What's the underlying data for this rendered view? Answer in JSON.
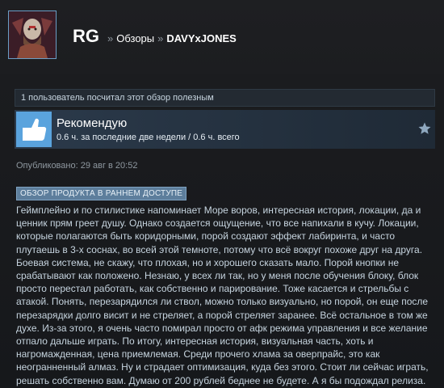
{
  "header": {
    "username": "RG",
    "sep1": "»",
    "section": "Обзоры",
    "sep2": "»",
    "game": "DAVYxJONES"
  },
  "helpful_text": "1 пользователь посчитал этот обзор полезным",
  "recommendation": {
    "title": "Рекомендую",
    "hours": "0.6 ч. за последние две недели / 0.6 ч. всего",
    "icon": "thumbs-up-icon",
    "award_icon": "star-icon"
  },
  "posted": "Опубликовано: 29 авг в 20:52",
  "early_access_badge": "ОБЗОР ПРОДУКТА В РАННЕМ ДОСТУПЕ",
  "review_text": "Геймплейно и по стилистике напоминает Море воров, интересная история, локации, да и ценник прям греет душу. Однако создается ощущение, что все напихали в кучу. Локации, которые полагаются быть коридорными, порой создают эффект лабиринта, и часто плутаешь в 3-х соснах, во всей этой темноте, потому что всё вокруг похоже друг на друга. Боевая система, не скажу, что плохая, но и хорошего сказать мало. Порой кнопки не срабатывают как положено. Незнаю, у всех ли так, но у меня после обучения блоку, блок просто перестал работать, как собственно и парирование. Тоже касается и стрельбы с атакой. Понять, перезарядился ли ствол, можно только визуально, но порой, он еще после перезарядки долго висит и не стреляет, а порой стреляет заранее. Всё остальное в том же духе. Из-за этого, я очень часто помирал просто от афк режима управления и все желание отпало дальше играть. По итогу, интересная история, визуальная часть, хоть и нагромажденная, цена приемлемая. Среди прочего хлама за оверпрайс, это как неогранненный алмаз. Ну и страдает оптимизация, куда без этого. Стоит ли сейчас играть, решать собственно вам. Думаю от 200 рублей беднее не будете. А я бы подождал релиза.",
  "colors": {
    "background": "#1b2838",
    "thumb": "#5aa3dd",
    "badge": "#5d7e9c"
  }
}
